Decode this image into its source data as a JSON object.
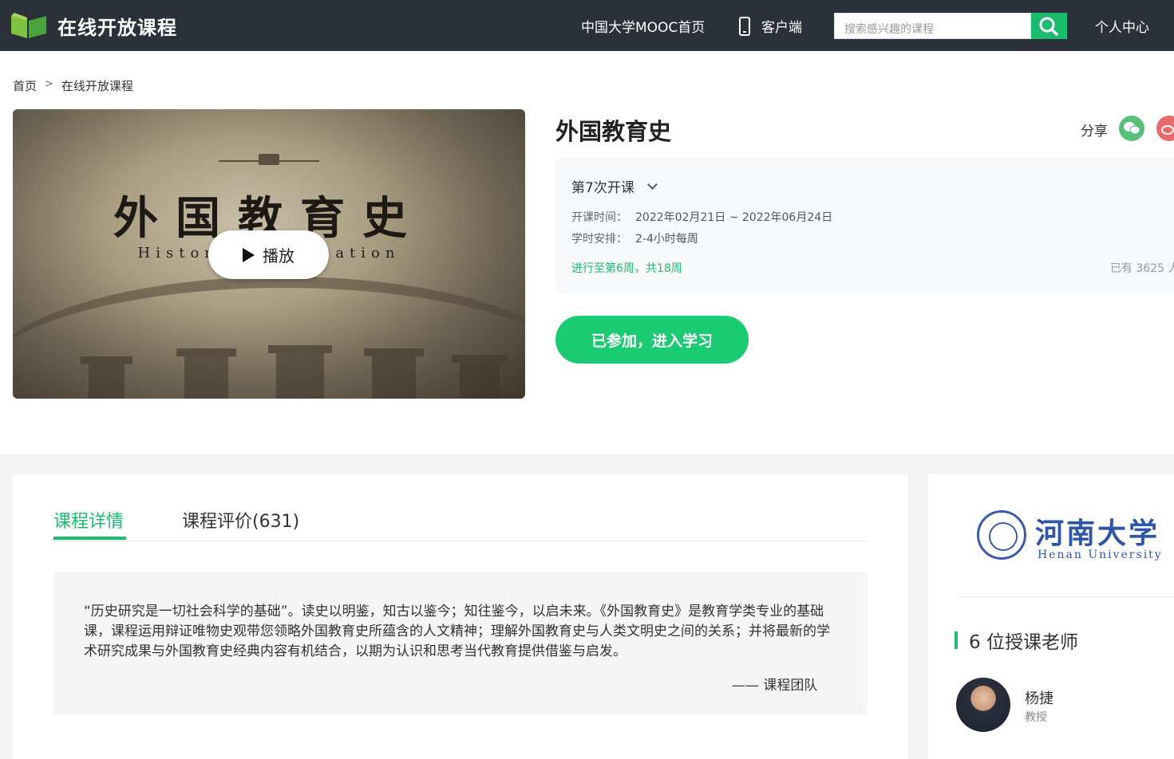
{
  "header": {
    "logo_text": "在线开放课程",
    "nav": {
      "mooc_home": "中国大学MOOC首页",
      "client": "客户端",
      "personal": "个人中心"
    },
    "search": {
      "placeholder": "搜索感兴趣的课程"
    }
  },
  "breadcrumb": {
    "home": "首页",
    "separator": ">",
    "current": "在线开放课程"
  },
  "video": {
    "title": "外国教育史",
    "subtitle": "History of Education",
    "play_label": "播放"
  },
  "course": {
    "title": "外国教育史",
    "share_label": "分享",
    "term": "第7次开课",
    "schedule_label": "开课时间：",
    "schedule_value": "2022年02月21日 ~ 2022年06月24日",
    "hours_label": "学时安排：",
    "hours_value": "2-4小时每周",
    "progress": "进行至第6周，共18周",
    "enrolled": "已有 3625 人",
    "join_button": "已参加，进入学习"
  },
  "tabs": {
    "detail": "课程详情",
    "review": "课程评价(631)"
  },
  "intro": {
    "quote": "“历史研究是一切社会科学的基础”。读史以明鉴，知古以鉴今；知往鉴今，以启未来。《外国教育史》是教育学类专业的基础课，课程运用辩证唯物史观带您领略外国教育史所蕴含的人文精神；理解外国教育史与人类文明史之间的关系；并将最新的学术研究成果与外国教育史经典内容有机结合，以期为认识和思考当代教育提供借鉴与启发。",
    "signature": "—— 课程团队"
  },
  "university": {
    "name_cn": "河南大学",
    "name_en": "Henan University"
  },
  "teachers": {
    "heading": "6 位授课老师",
    "list": [
      {
        "name": "杨捷",
        "title": "教授"
      }
    ]
  },
  "colors": {
    "accent": "#1bbc6e",
    "topbar": "#2c3039",
    "university_blue": "#2f56a6"
  }
}
